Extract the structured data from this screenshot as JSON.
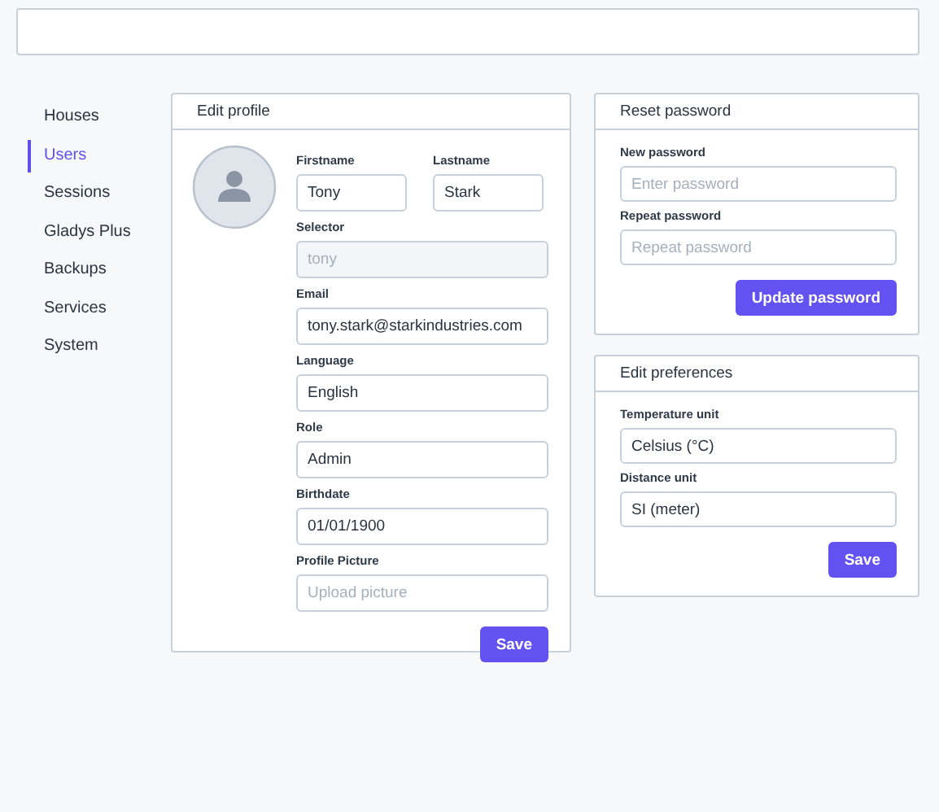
{
  "sidebar": {
    "items": [
      {
        "label": "Houses",
        "selected": false
      },
      {
        "label": "Users",
        "selected": true
      },
      {
        "label": "Sessions",
        "selected": false
      },
      {
        "label": "Gladys Plus",
        "selected": false
      },
      {
        "label": "Backups",
        "selected": false
      },
      {
        "label": "Services",
        "selected": false
      },
      {
        "label": "System",
        "selected": false
      }
    ]
  },
  "edit_profile": {
    "title": "Edit profile",
    "name_fields": [
      {
        "label": "Firstname",
        "value": "Tony",
        "disabled": false
      },
      {
        "label": "Lastname",
        "value": "Stark",
        "disabled": false
      }
    ],
    "fields": [
      {
        "label": "Selector",
        "value": "tony",
        "disabled": true
      },
      {
        "label": "Email",
        "value": "tony.stark@starkindustries.com",
        "disabled": false
      },
      {
        "label": "Language",
        "value": "English",
        "disabled": false
      },
      {
        "label": "Role",
        "value": "Admin",
        "disabled": false
      },
      {
        "label": "Birthdate",
        "value": "01/01/1900",
        "disabled": false
      },
      {
        "label": "Profile Picture",
        "placeholder": "Upload picture",
        "disabled": false
      }
    ],
    "button": "Save"
  },
  "reset_password": {
    "title": "Reset password",
    "fields": [
      {
        "label": "New password",
        "placeholder": "Enter password"
      },
      {
        "label": "Repeat password",
        "placeholder": "Repeat password"
      }
    ],
    "button": "Update password"
  },
  "edit_preferences": {
    "title": "Edit preferences",
    "fields": [
      {
        "label": "Temperature unit",
        "value": "Celsius (°C)"
      },
      {
        "label": "Distance unit",
        "value": "SI (meter)"
      }
    ],
    "button": "Save"
  }
}
